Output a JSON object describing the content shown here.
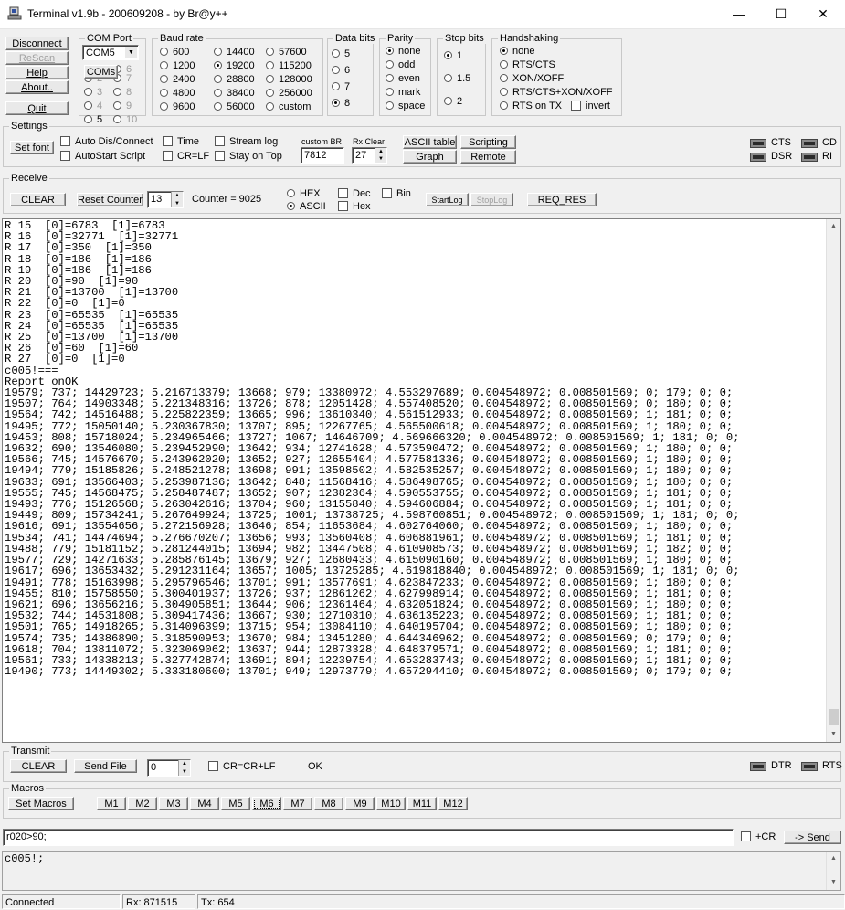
{
  "window": {
    "title": "Terminal v1.9b - 200609208 - by Br@y++",
    "min_glyph": "—",
    "max_glyph": "☐",
    "close_glyph": "✕"
  },
  "conn": {
    "disconnect": "Disconnect",
    "rescan": "ReScan",
    "help": "Help",
    "about": "About..",
    "quit": "Quit"
  },
  "comport": {
    "title": "COM Port",
    "selected": "COM5",
    "coms_button": "COMs",
    "options": [
      "1",
      "2",
      "3",
      "4",
      "5",
      "6",
      "7",
      "8",
      "9",
      "10"
    ]
  },
  "baud": {
    "title": "Baud rate",
    "options": [
      "600",
      "1200",
      "2400",
      "4800",
      "9600",
      "14400",
      "19200",
      "28800",
      "38400",
      "56000",
      "57600",
      "115200",
      "128000",
      "256000",
      "custom"
    ],
    "selected": "19200"
  },
  "databits": {
    "title": "Data bits",
    "options": [
      "5",
      "6",
      "7",
      "8"
    ],
    "selected": "8"
  },
  "parity": {
    "title": "Parity",
    "options": [
      "none",
      "odd",
      "even",
      "mark",
      "space"
    ],
    "selected": "none"
  },
  "stopbits": {
    "title": "Stop bits",
    "options": [
      "1",
      "1.5",
      "2"
    ],
    "selected": "1"
  },
  "handshaking": {
    "title": "Handshaking",
    "options": [
      "none",
      "RTS/CTS",
      "XON/XOFF",
      "RTS/CTS+XON/XOFF",
      "RTS on TX"
    ],
    "selected": "none",
    "invert": "invert"
  },
  "settings": {
    "title": "Settings",
    "setfont": "Set font",
    "auto_dis": "Auto Dis/Connect",
    "autostart": "AutoStart Script",
    "time": "Time",
    "crlf": "CR=LF",
    "streamlog": "Stream log",
    "stayontop": "Stay on Top",
    "custombr_label": "custom BR",
    "custombr_value": "7812",
    "rxclear_label": "Rx Clear",
    "rxclear_value": "27",
    "ascii_table": "ASCII table",
    "graph": "Graph",
    "scripting": "Scripting",
    "remote": "Remote",
    "leds": [
      "CTS",
      "CD",
      "DSR",
      "RI"
    ]
  },
  "receive": {
    "title": "Receive",
    "clear": "CLEAR",
    "reset_counter": "Reset Counter",
    "spin_value": "13",
    "counter_label": "Counter = 9025",
    "hex": "HEX",
    "ascii": "ASCII",
    "dec": "Dec",
    "bin": "Bin",
    "hex2": "Hex",
    "startlog": "StartLog",
    "stoplog": "StopLog",
    "req_res": "REQ_RES"
  },
  "terminal_lines": [
    "R 15  [0]=6783  [1]=6783",
    "R 16  [0]=32771  [1]=32771",
    "R 17  [0]=350  [1]=350",
    "R 18  [0]=186  [1]=186",
    "R 19  [0]=186  [1]=186",
    "R 20  [0]=90  [1]=90",
    "R 21  [0]=13700  [1]=13700",
    "R 22  [0]=0  [1]=0",
    "R 23  [0]=65535  [1]=65535",
    "R 24  [0]=65535  [1]=65535",
    "R 25  [0]=13700  [1]=13700",
    "R 26  [0]=60  [1]=60",
    "R 27  [0]=0  [1]=0",
    "c005!===",
    "Report onOK",
    "19579; 737; 14429723; 5.216713379; 13668; 979; 13380972; 4.553297689; 0.004548972; 0.008501569; 0; 179; 0; 0;",
    "19507; 764; 14903348; 5.221348316; 13726; 878; 12051428; 4.557408520; 0.004548972; 0.008501569; 0; 180; 0; 0;",
    "19564; 742; 14516488; 5.225822359; 13665; 996; 13610340; 4.561512933; 0.004548972; 0.008501569; 1; 181; 0; 0;",
    "19495; 772; 15050140; 5.230367830; 13707; 895; 12267765; 4.565500618; 0.004548972; 0.008501569; 1; 180; 0; 0;",
    "19453; 808; 15718024; 5.234965466; 13727; 1067; 14646709; 4.569666320; 0.004548972; 0.008501569; 1; 181; 0; 0;",
    "19632; 690; 13546080; 5.239452990; 13642; 934; 12741628; 4.573590472; 0.004548972; 0.008501569; 1; 180; 0; 0;",
    "19566; 745; 14576670; 5.243962020; 13652; 927; 12655404; 4.577581336; 0.004548972; 0.008501569; 1; 180; 0; 0;",
    "19494; 779; 15185826; 5.248521278; 13698; 991; 13598502; 4.582535257; 0.004548972; 0.008501569; 1; 180; 0; 0;",
    "19633; 691; 13566403; 5.253987136; 13642; 848; 11568416; 4.586498765; 0.004548972; 0.008501569; 1; 180; 0; 0;",
    "19555; 745; 14568475; 5.258487487; 13652; 907; 12382364; 4.590553755; 0.004548972; 0.008501569; 1; 181; 0; 0;",
    "19493; 776; 15126568; 5.263042616; 13704; 960; 13155840; 4.594606884; 0.004548972; 0.008501569; 1; 181; 0; 0;",
    "19449; 809; 15734241; 5.267649924; 13725; 1001; 13738725; 4.598760851; 0.004548972; 0.008501569; 1; 181; 0; 0;",
    "19616; 691; 13554656; 5.272156928; 13646; 854; 11653684; 4.602764060; 0.004548972; 0.008501569; 1; 180; 0; 0;",
    "19534; 741; 14474694; 5.276670207; 13656; 993; 13560408; 4.606881961; 0.004548972; 0.008501569; 1; 181; 0; 0;",
    "19488; 779; 15181152; 5.281244015; 13694; 982; 13447508; 4.610908573; 0.004548972; 0.008501569; 1; 182; 0; 0;",
    "19577; 729; 14271633; 5.285876145; 13679; 927; 12680433; 4.615090160; 0.004548972; 0.008501569; 1; 180; 0; 0;",
    "19617; 696; 13653432; 5.291231164; 13657; 1005; 13725285; 4.619818840; 0.004548972; 0.008501569; 1; 181; 0; 0;",
    "19491; 778; 15163998; 5.295796546; 13701; 991; 13577691; 4.623847233; 0.004548972; 0.008501569; 1; 180; 0; 0;",
    "19455; 810; 15758550; 5.300401937; 13726; 937; 12861262; 4.627998914; 0.004548972; 0.008501569; 1; 181; 0; 0;",
    "19621; 696; 13656216; 5.304905851; 13644; 906; 12361464; 4.632051824; 0.004548972; 0.008501569; 1; 180; 0; 0;",
    "19532; 744; 14531808; 5.309417436; 13667; 930; 12710310; 4.636135223; 0.004548972; 0.008501569; 1; 181; 0; 0;",
    "19501; 765; 14918265; 5.314096399; 13715; 954; 13084110; 4.640195704; 0.004548972; 0.008501569; 1; 180; 0; 0;",
    "19574; 735; 14386890; 5.318590953; 13670; 984; 13451280; 4.644346962; 0.004548972; 0.008501569; 0; 179; 0; 0;",
    "19618; 704; 13811072; 5.323069062; 13637; 944; 12873328; 4.648379571; 0.004548972; 0.008501569; 1; 181; 0; 0;",
    "19561; 733; 14338213; 5.327742874; 13691; 894; 12239754; 4.653283743; 0.004548972; 0.008501569; 1; 181; 0; 0;",
    "19490; 773; 14449302; 5.333180600; 13701; 949; 12973779; 4.657294410; 0.004548972; 0.008501569; 0; 179; 0; 0;"
  ],
  "transmit": {
    "title": "Transmit",
    "clear": "CLEAR",
    "sendfile": "Send File",
    "spin_value": "0",
    "crcrlf": "CR=CR+LF",
    "status": "OK",
    "leds": [
      "DTR",
      "RTS"
    ]
  },
  "macros": {
    "title": "Macros",
    "set": "Set Macros",
    "items": [
      "M1",
      "M2",
      "M3",
      "M4",
      "M5",
      "M6",
      "M7",
      "M8",
      "M9",
      "M10",
      "M11",
      "M12"
    ]
  },
  "send": {
    "input_value": "r020>90;",
    "cr": "+CR",
    "send": "-> Send"
  },
  "output": {
    "text": "c005!;"
  },
  "status": {
    "connected": "Connected",
    "rx": "Rx: 871515",
    "tx": "Tx: 654"
  }
}
